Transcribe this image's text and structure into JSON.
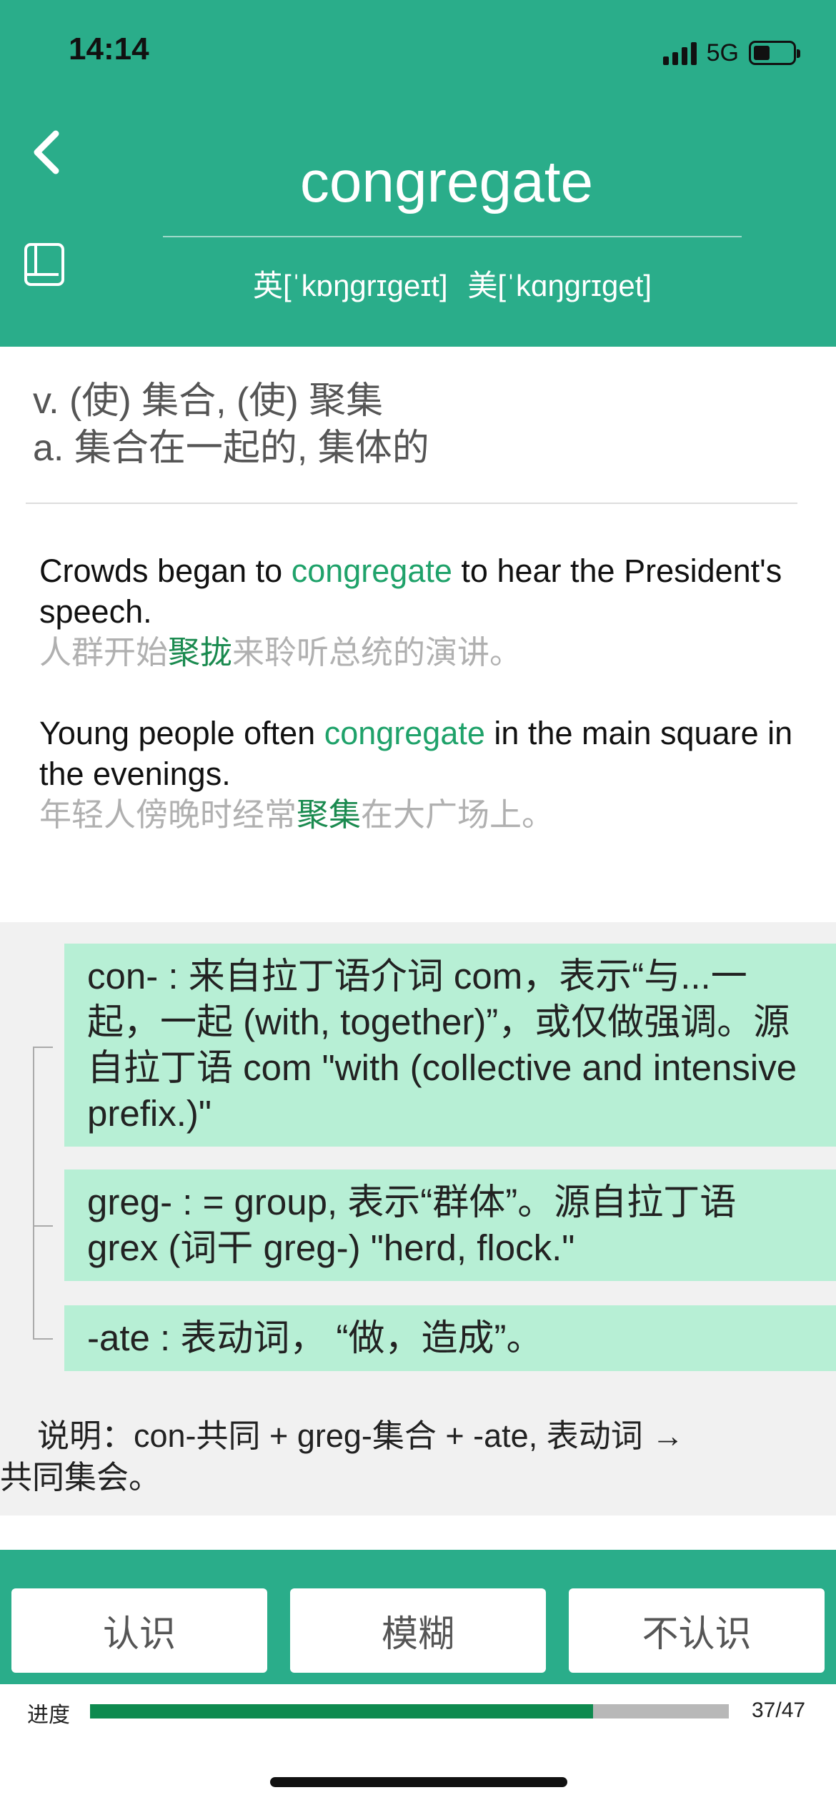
{
  "status": {
    "time": "14:14",
    "network": "5G",
    "battery_level": 0.42
  },
  "header": {
    "word": "congregate",
    "phonetic_uk": "英[ˈkɒŋɡrɪɡeɪt]",
    "phonetic_us": "美[ˈkɑŋɡrɪɡet]",
    "back_icon": "chevron-left-icon",
    "book_icon": "notebook-icon"
  },
  "definitions": [
    "v. (使) 集合, (使) 聚集",
    "a. 集合在一起的, 集体的"
  ],
  "examples": [
    {
      "en_before": "Crowds began to ",
      "en_word": "congregate",
      "en_after": " to hear the President's speech.",
      "zh_before": "人群开始",
      "zh_word": "聚拢",
      "zh_after": "来聆听总统的演讲。"
    },
    {
      "en_before": "Young people often ",
      "en_word": "congregate",
      "en_after": " in the main square in the evenings.",
      "zh_before": "年轻人傍晚时经常",
      "zh_word": "聚集",
      "zh_after": "在大广场上。"
    }
  ],
  "etymology": {
    "parts": [
      "con- : 来自拉丁语介词 com，表示“与...一起，一起 (with, together)”，或仅做强调。源自拉丁语 com \"with (collective and intensive prefix.)\"",
      "greg- : = group, 表示“群体”。源自拉丁语 grex (词干 greg-) \"herd, flock.\"",
      "-ate : 表动词， “做，造成”。"
    ],
    "note_line1": "说明：con-共同 + greg-集合 + -ate, 表动词 →",
    "note_line2": "共同集会。"
  },
  "actions": {
    "know": "认识",
    "vague": "模糊",
    "unknown": "不认识"
  },
  "progress": {
    "label": "进度",
    "current": 37,
    "total": 47,
    "text": "37/47"
  },
  "colors": {
    "brand": "#2aad8a",
    "highlight": "#1fa26a",
    "morph_bg": "#b7efd5",
    "progress": "#0e8a4f"
  }
}
